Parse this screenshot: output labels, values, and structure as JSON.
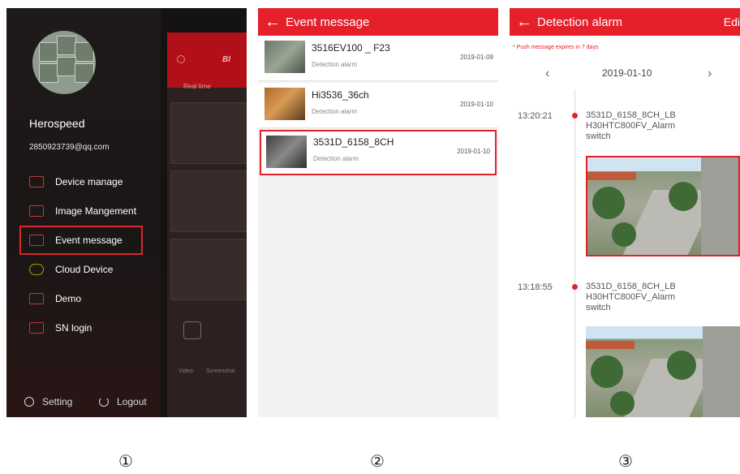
{
  "screen1": {
    "user_name": "Herospeed",
    "email": "2850923739@qq.com",
    "menu": [
      {
        "label": "Device manage",
        "icon": "camera-icon"
      },
      {
        "label": "Image Mangement",
        "icon": "image-icon"
      },
      {
        "label": "Event message",
        "icon": "envelope-icon"
      },
      {
        "label": "Cloud Device",
        "icon": "cloud-icon"
      },
      {
        "label": "Demo",
        "icon": "monitor-icon"
      },
      {
        "label": "SN login",
        "icon": "barcode-icon"
      }
    ],
    "setting_label": "Setting",
    "logout_label": "Logout",
    "background": {
      "realtime_label": "Real time",
      "brand_fragment": "BI",
      "video_label": "Video",
      "screenshot_label": "Screenshot"
    }
  },
  "screen2": {
    "title": "Event message",
    "events": [
      {
        "name": "3516EV100 _ F23",
        "type": "Detection alarm",
        "date": "2019-01-09"
      },
      {
        "name": "Hi3536_36ch",
        "type": "Detection alarm",
        "date": "2019-01-10"
      },
      {
        "name": "3531D_6158_8CH",
        "type": "Detection alarm",
        "date": "2019-01-10"
      }
    ]
  },
  "screen3": {
    "title": "Detection alarm",
    "edit_label": "Edi",
    "push_note": "* Push message expires in 7 days",
    "date": "2019-01-10",
    "alarms": [
      {
        "time": "13:20:21",
        "line1": "3531D_6158_8CH_LB",
        "line2": "H30HTC800FV_Alarm",
        "line3": "switch"
      },
      {
        "time": "13:18:55",
        "line1": "3531D_6158_8CH_LB",
        "line2": "H30HTC800FV_Alarm",
        "line3": "switch"
      }
    ]
  },
  "captions": [
    "①",
    "②",
    "③"
  ],
  "colors": {
    "accent": "#e5202b",
    "drawer_bg": "#1b1616"
  }
}
